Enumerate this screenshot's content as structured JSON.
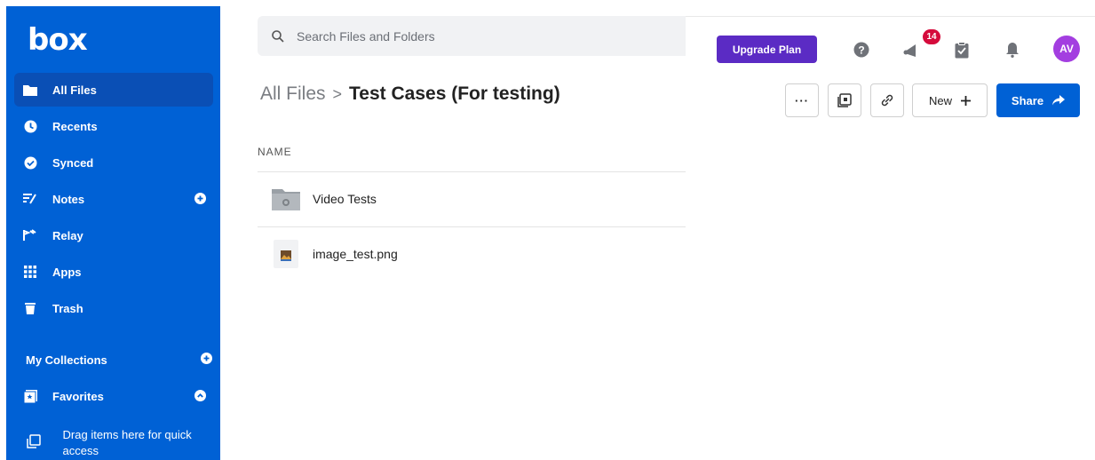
{
  "app": {
    "logo": "box"
  },
  "sidebar": {
    "items": [
      {
        "label": "All Files",
        "icon": "folder-icon"
      },
      {
        "label": "Recents",
        "icon": "clock-icon"
      },
      {
        "label": "Synced",
        "icon": "check-circle-icon"
      },
      {
        "label": "Notes",
        "icon": "notes-icon"
      },
      {
        "label": "Relay",
        "icon": "relay-icon"
      },
      {
        "label": "Apps",
        "icon": "apps-grid-icon"
      },
      {
        "label": "Trash",
        "icon": "trash-icon"
      }
    ],
    "collections_label": "My Collections",
    "favorites_label": "Favorites",
    "drag_hint": "Drag items here for quick access"
  },
  "search": {
    "placeholder": "Search Files and Folders"
  },
  "header": {
    "upgrade_label": "Upgrade Plan",
    "notification_count": "14",
    "avatar_initials": "AV"
  },
  "breadcrumb": {
    "root": "All Files",
    "separator": ">",
    "current": "Test Cases (For testing)"
  },
  "actions": {
    "more": "···",
    "new_label": "New",
    "share_label": "Share"
  },
  "list": {
    "column_name": "NAME",
    "rows": [
      {
        "name": "Video Tests",
        "type": "folder"
      },
      {
        "name": "image_test.png",
        "type": "image"
      }
    ]
  },
  "colors": {
    "brand": "#0061d5",
    "upgrade": "#5b2bc4",
    "badge": "#d50b3c",
    "avatar": "#a33ee0"
  }
}
